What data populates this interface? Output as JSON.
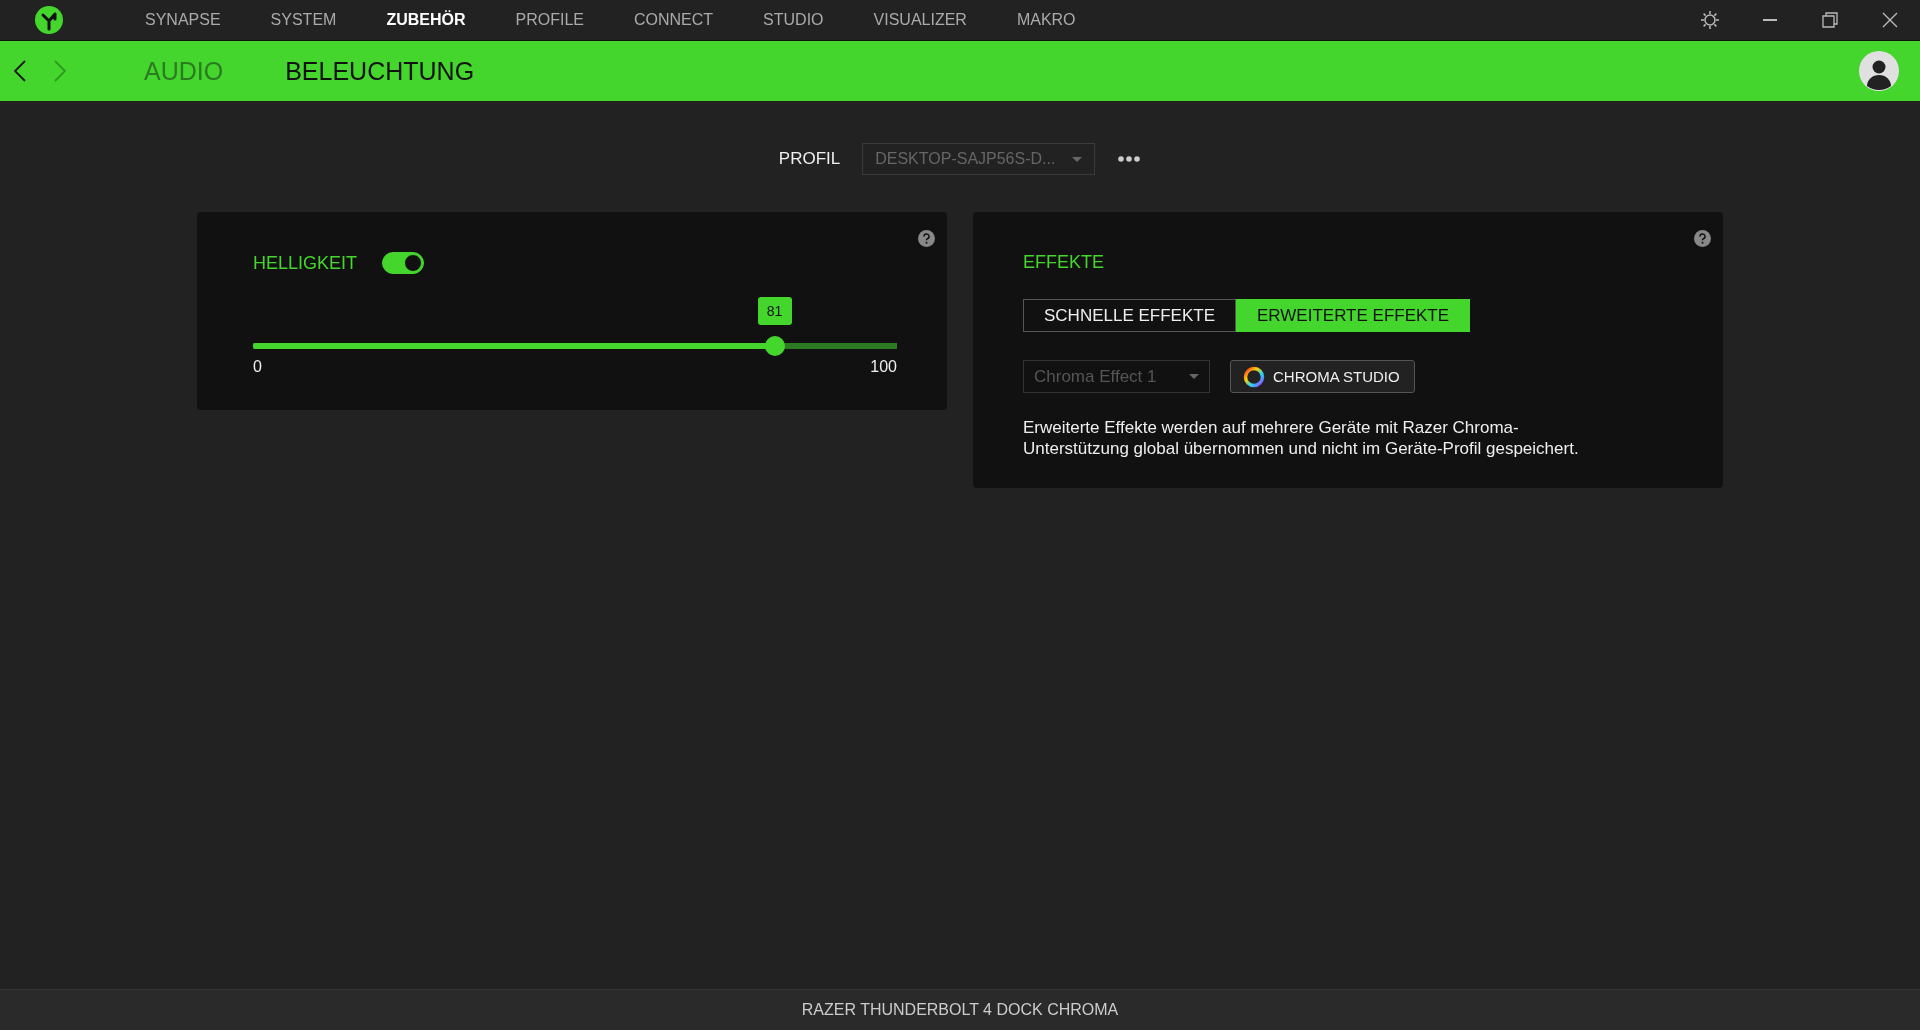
{
  "nav_tabs": [
    {
      "label": "SYNAPSE",
      "selected": false
    },
    {
      "label": "SYSTEM",
      "selected": false
    },
    {
      "label": "ZUBEHÖR",
      "selected": true
    },
    {
      "label": "PROFILE",
      "selected": false
    },
    {
      "label": "CONNECT",
      "selected": false
    },
    {
      "label": "STUDIO",
      "selected": false
    },
    {
      "label": "VISUALIZER",
      "selected": false
    },
    {
      "label": "MAKRO",
      "selected": false
    }
  ],
  "sub_nav": {
    "back_disabled": false,
    "forward_disabled": true,
    "tabs": [
      {
        "label": "AUDIO",
        "selected": false
      },
      {
        "label": "BELEUCHTUNG",
        "selected": true
      }
    ]
  },
  "profile": {
    "label": "PROFIL",
    "value": "DESKTOP-SAJP56S-D..."
  },
  "brightness": {
    "title": "HELLIGKEIT",
    "on": true,
    "level": 0.81,
    "reading": "81",
    "min_label": "0",
    "max_label": "100"
  },
  "effects": {
    "title": "EFFEKTE",
    "modes": [
      {
        "label": "SCHNELLE EFFEKTE",
        "selected": false
      },
      {
        "label": "ERWEITERTE EFFEKTE",
        "selected": true
      }
    ],
    "effect_select": {
      "value": "Chroma Effect 1",
      "disabled": true
    },
    "studio_button": "CHROMA STUDIO",
    "description": "Erweiterte Effekte werden auf mehrere Geräte mit Razer Chroma-Unterstützung global übernommen und nicht im Geräte-Profil gespeichert."
  },
  "status_bar": {
    "device": "RAZER THUNDERBOLT 4 DOCK CHROMA"
  }
}
